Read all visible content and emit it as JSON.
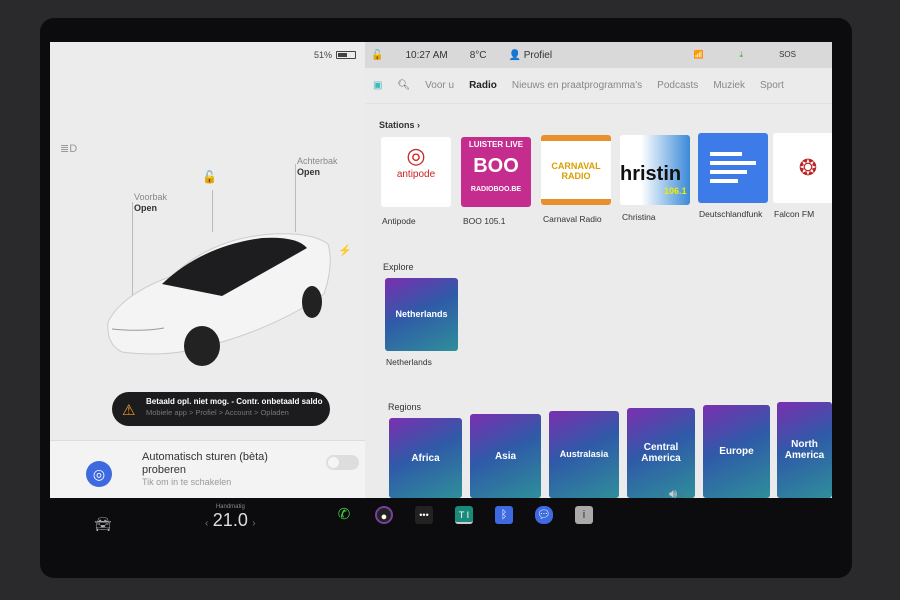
{
  "status": {
    "battery": "51%",
    "time": "10:27 AM",
    "temperature": "8°C",
    "profile": "Profiel"
  },
  "vehicle": {
    "frunk_label": "Voorbak",
    "frunk_state": "Open",
    "trunk_label": "Achterbak",
    "trunk_state": "Open",
    "color": "#f4f4f4"
  },
  "toast": {
    "title": "Betaald opl. niet mog. - Contr. onbetaald saldo",
    "subtitle": "Mobiele app > Profiel > Account > Opladen",
    "icon": "warning-icon"
  },
  "autopilot": {
    "title": "Automatisch sturen (bèta) proberen",
    "subtitle": "Tik om in te schakelen",
    "enabled": false
  },
  "media": {
    "tabs": [
      {
        "label": "Voor u"
      },
      {
        "label": "Radio",
        "active": true
      },
      {
        "label": "Nieuws en praatprogramma's"
      },
      {
        "label": "Podcasts"
      },
      {
        "label": "Muziek"
      },
      {
        "label": "Sport"
      }
    ],
    "stations_title": "Stations",
    "stations": [
      {
        "name": "Antipode",
        "logo": "antipode"
      },
      {
        "name": "BOO 105.1",
        "logo": "BOO",
        "logo_top": "LUISTER LIVE",
        "logo_bottom": "RADIOBOO.BE"
      },
      {
        "name": "Carnaval Radio",
        "logo": "CARNAVAL RADIO"
      },
      {
        "name": "Christina",
        "logo": "hristin",
        "logo_sub": "106.1"
      },
      {
        "name": "Deutschlandfunk"
      },
      {
        "name": "Falcon FM"
      }
    ],
    "explore_title": "Explore",
    "explore": [
      {
        "name": "Netherlands",
        "tile": "Netherlands"
      }
    ],
    "regions_title": "Regions",
    "regions": [
      "Africa",
      "Asia",
      "Australasia",
      "Central America",
      "Europe",
      "North America"
    ]
  },
  "climate": {
    "mode": "Handmatig",
    "temperature": "21.0"
  },
  "accent": "#3e6ae1"
}
